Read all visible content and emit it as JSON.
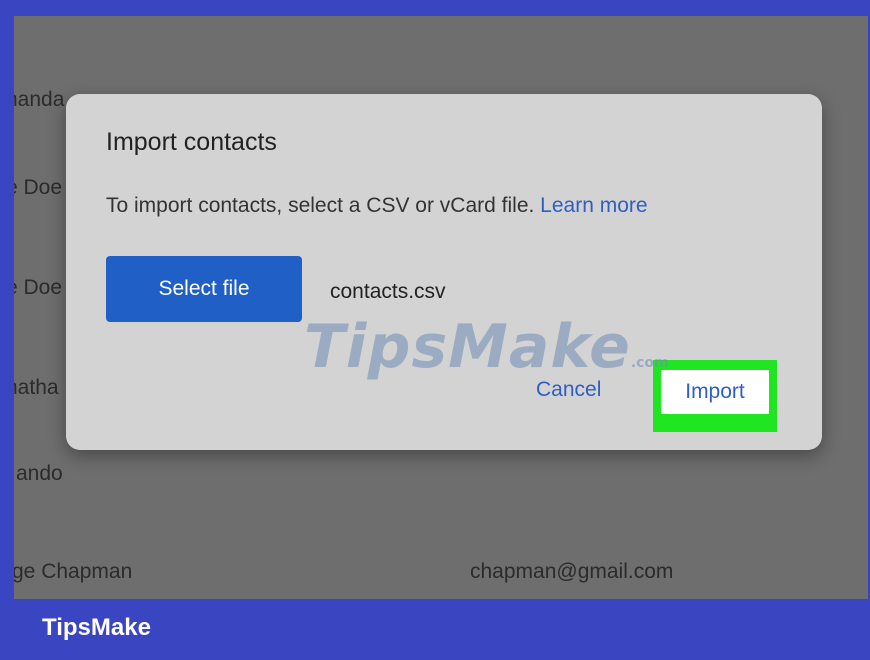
{
  "background_list": {
    "rows": [
      "nanda",
      "e Doe",
      "e Doe",
      "natha",
      "ando",
      "ge Chapman"
    ],
    "email": "chapman@gmail.com"
  },
  "dialog": {
    "title": "Import contacts",
    "description": "To import contacts, select a CSV or vCard file.",
    "learn_more": "Learn more",
    "select_file_label": "Select file",
    "file_name": "contacts.csv",
    "cancel_label": "Cancel",
    "import_label": "Import"
  },
  "watermark": {
    "text": "TipsMake",
    "suffix": ".com"
  },
  "footer": {
    "brand": "TipsMake"
  },
  "colors": {
    "frame": "#3a45c2",
    "overlay": "#6e6e6e",
    "dialog": "#d3d3d3",
    "primary_button": "#1f5fc6",
    "link": "#2f5ec4",
    "highlight": "#1fe620"
  }
}
